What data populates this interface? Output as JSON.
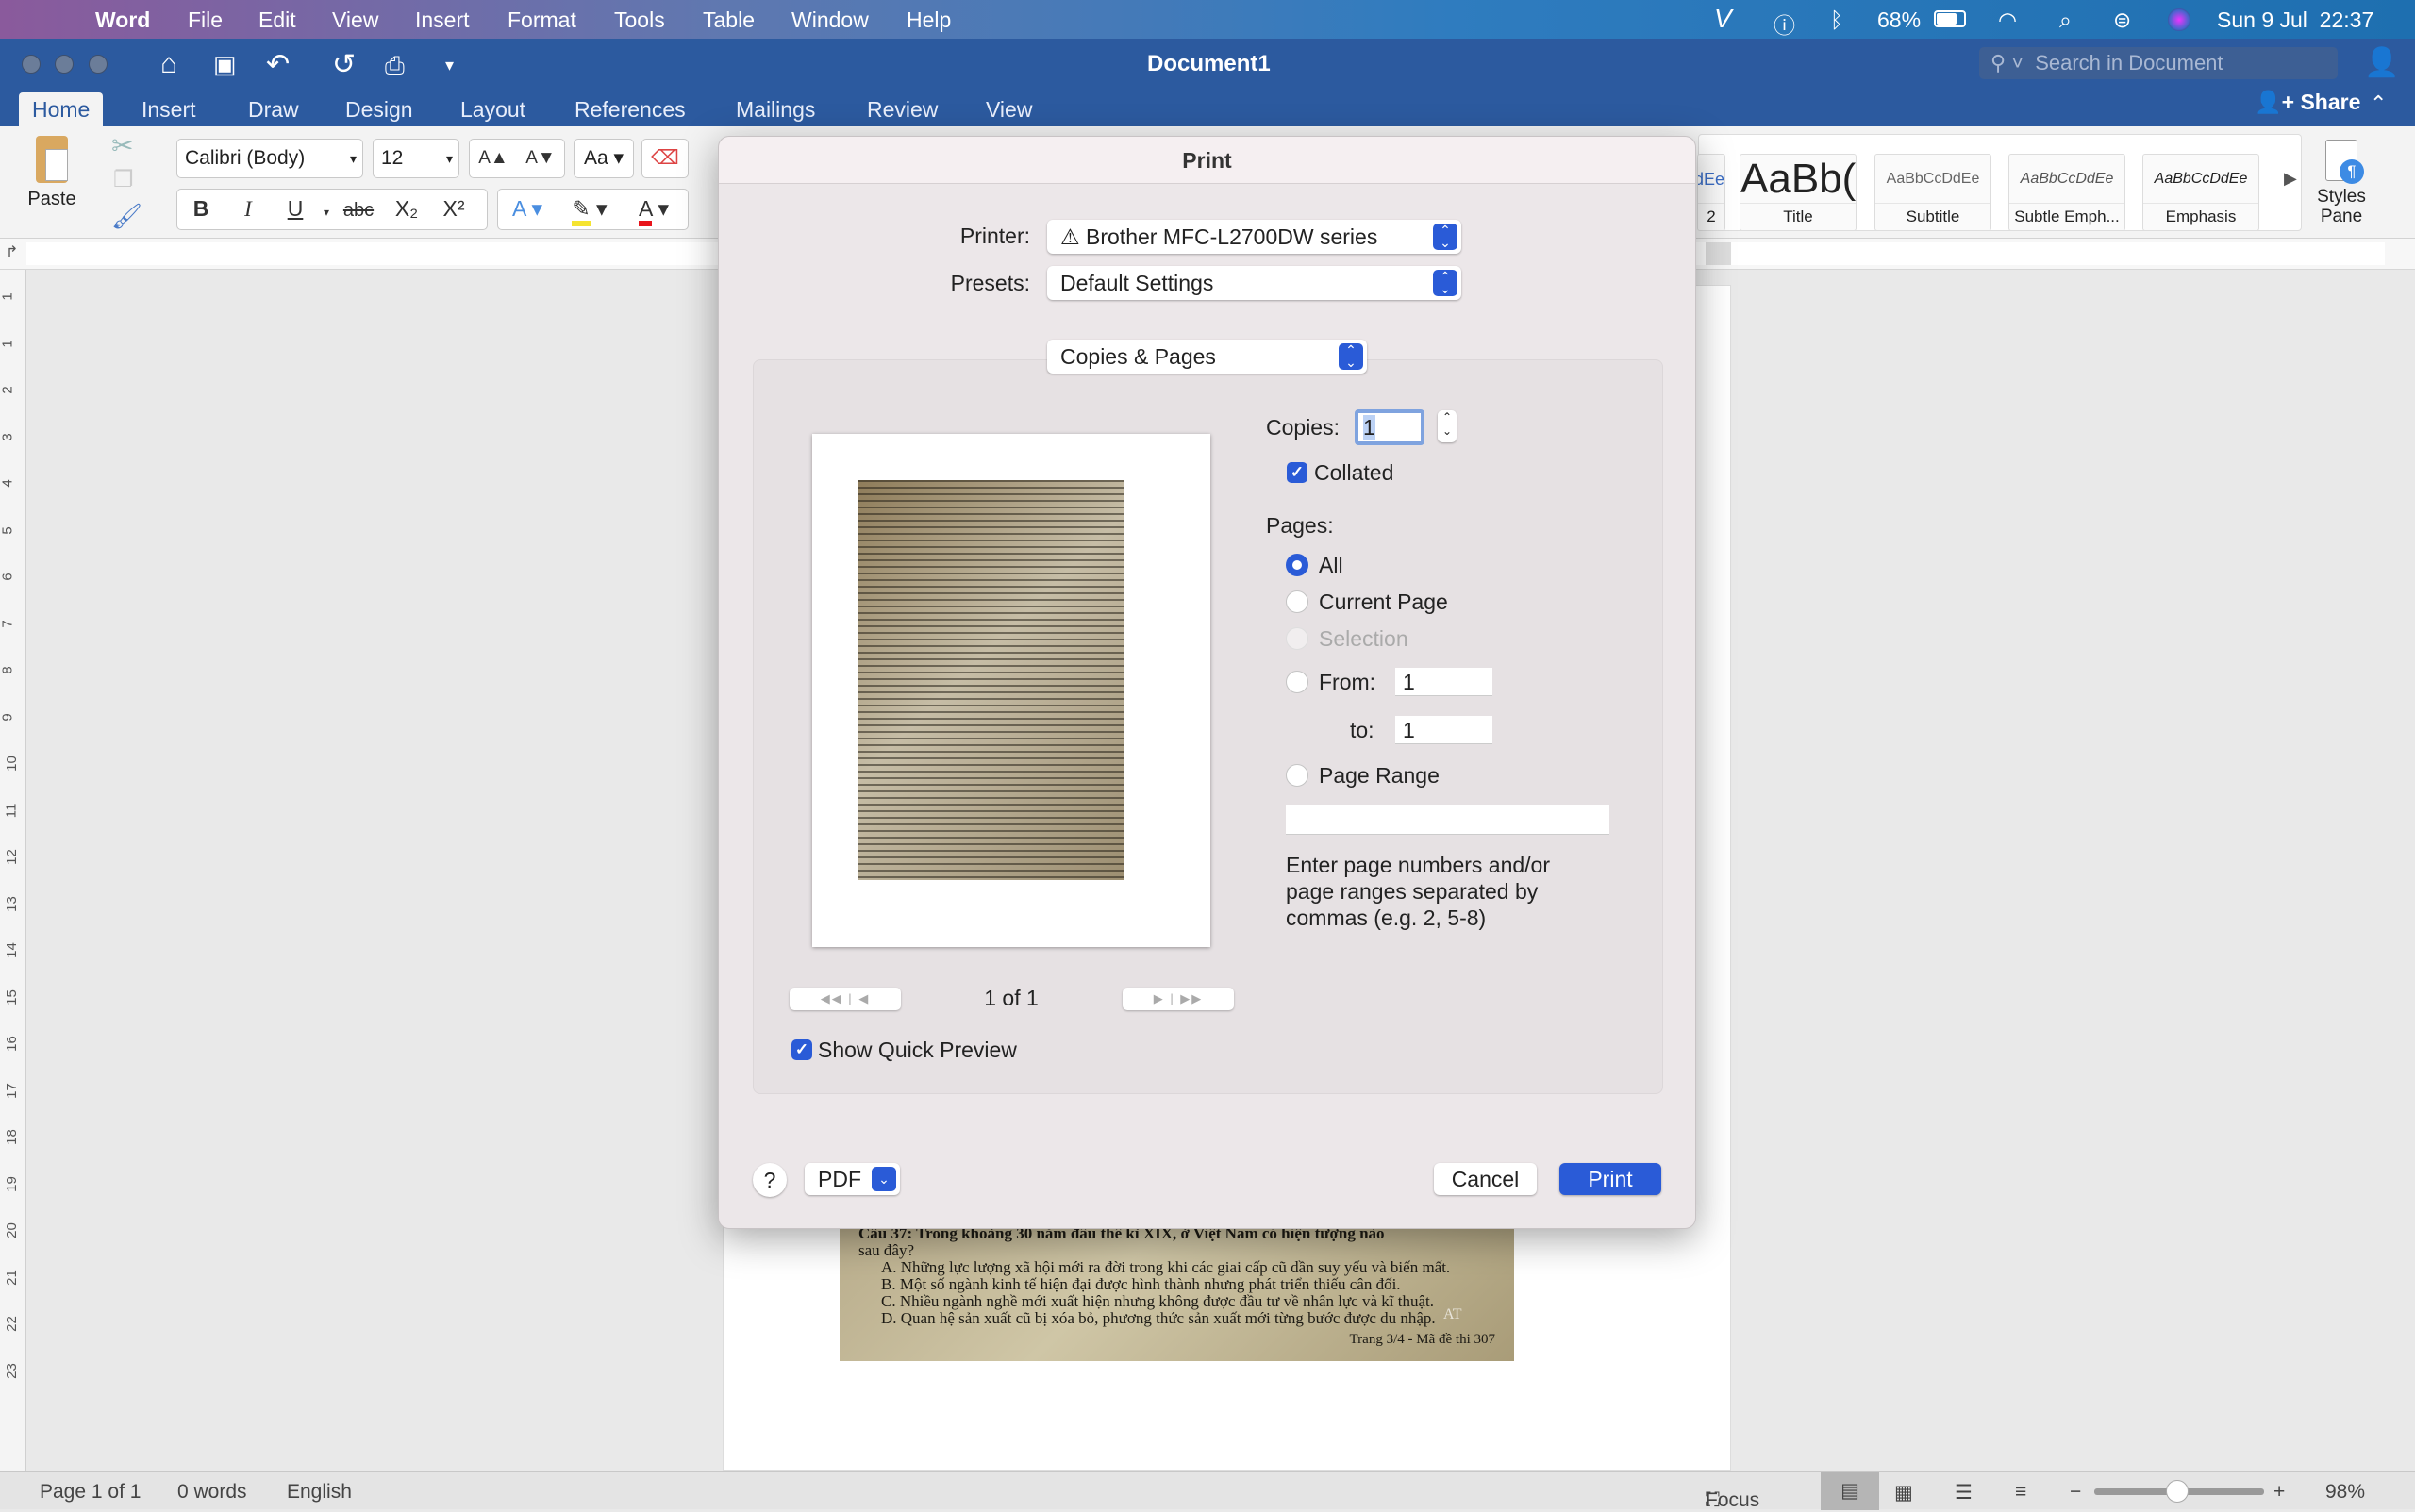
{
  "menubar": {
    "app": "Word",
    "items": [
      "File",
      "Edit",
      "View",
      "Insert",
      "Format",
      "Tools",
      "Table",
      "Window",
      "Help"
    ],
    "battery": "68%",
    "datetime": "Sun 9 Jul  22:37",
    "battery_level_percent": 68
  },
  "titlebar": {
    "title": "Document1",
    "search_placeholder": "Search in Document"
  },
  "tabs": [
    "Home",
    "Insert",
    "Draw",
    "Design",
    "Layout",
    "References",
    "Mailings",
    "Review",
    "View"
  ],
  "active_tab": "Home",
  "share": "Share",
  "ribbon": {
    "paste": "Paste",
    "font_name": "Calibri (Body)",
    "font_size": "12",
    "bold": "B",
    "italic": "I",
    "underline": "U",
    "strike": "abc",
    "subscript": "X₂",
    "superscript": "X²",
    "grow": "A▲",
    "shrink": "A▼",
    "change_case": "Aa",
    "styles": [
      {
        "preview": "AaBbCcDdEe",
        "name": "2"
      },
      {
        "preview": "AaBb(",
        "name": "Title"
      },
      {
        "preview": "AaBbCcDdEe",
        "name": "Subtitle"
      },
      {
        "preview": "AaBbCcDdEe",
        "name": "Subtle Emph..."
      },
      {
        "preview": "AaBbCcDdEe",
        "name": "Emphasis"
      }
    ],
    "styles_pane": "Styles Pane",
    "highlight_color": "#f5e431",
    "font_color": "#e8141b"
  },
  "vruler": [
    "1",
    "1",
    "2",
    "3",
    "4",
    "5",
    "6",
    "7",
    "8",
    "9",
    "10",
    "11",
    "12",
    "13",
    "14",
    "15",
    "16",
    "17",
    "18",
    "19",
    "20",
    "21",
    "22",
    "23"
  ],
  "document": {
    "lines": [
      "Câu 37: Trong khoảng 30 năm đầu thế kỉ XIX, ở Việt Nam có hiện tượng nào",
      "sau đây?",
      "A. Những lực lượng xã hội mới ra đời trong khi các giai cấp cũ dần suy yếu và biến mất.",
      "B. Một số ngành kinh tế hiện đại được hình thành nhưng phát triển thiếu cân đối.",
      "C. Nhiều ngành nghề mới xuất hiện nhưng không được đầu tư về nhân lực và kĩ thuật.",
      "D. Quan hệ sản xuất cũ bị xóa bỏ, phương thức sản xuất mới từng bước được du nhập."
    ],
    "footer": "Trang 3/4 - Mã đề thi 307",
    "watermark": "AT"
  },
  "status": {
    "page": "Page 1 of 1",
    "words": "0 words",
    "language": "English",
    "focus": "Focus",
    "zoom": "98%",
    "zoom_percent": 98
  },
  "print_dialog": {
    "title": "Print",
    "printer_label": "Printer:",
    "printer": "Brother MFC-L2700DW series",
    "presets_label": "Presets:",
    "presets": "Default Settings",
    "section": "Copies & Pages",
    "page_indicator": "1 of 1",
    "show_quick_preview": "Show Quick Preview",
    "show_quick_preview_checked": true,
    "copies_label": "Copies:",
    "copies": "1",
    "collated": "Collated",
    "collated_checked": true,
    "pages_label": "Pages:",
    "options": {
      "all": "All",
      "current": "Current Page",
      "selection": "Selection",
      "from": "From:",
      "to": "to:",
      "range": "Page Range"
    },
    "selected_option": "All",
    "from_value": "1",
    "to_value": "1",
    "range_value": "",
    "range_help": "Enter page numbers and/or page ranges separated by commas (e.g. 2, 5-8)",
    "help": "?",
    "pdf": "PDF",
    "cancel": "Cancel",
    "print": "Print",
    "accent": "#2a5bd7"
  }
}
